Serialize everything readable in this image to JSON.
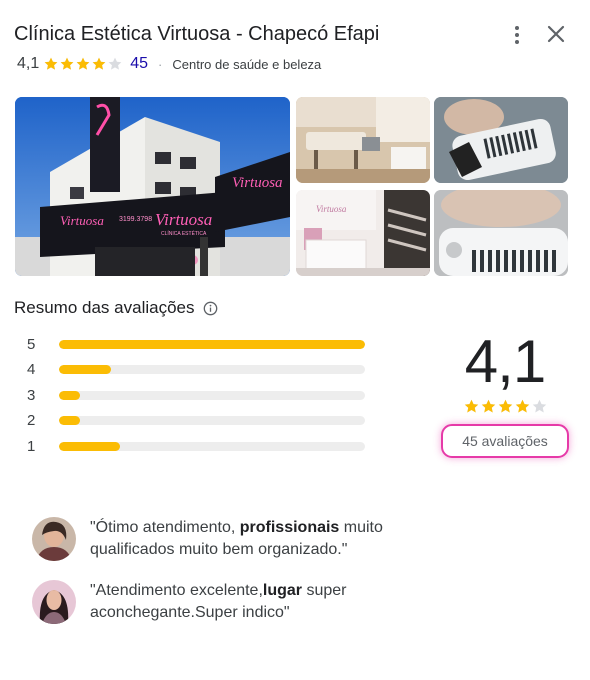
{
  "header": {
    "title": "Clínica Estética Virtuosa - Chapecó Efapi",
    "rating": "4,1",
    "review_count": "45",
    "separator": "·",
    "category": "Centro de saúde e beleza",
    "menu_icon": "more-vert-icon",
    "close_icon": "close-icon"
  },
  "photos": {
    "facade_sign": "Virtuosa",
    "facade_sub": "CLÍNICA ESTÉTICA",
    "facade_phone": "3199.3798",
    "reception_sign": "Virtuosa"
  },
  "summary": {
    "title": "Resumo das avaliações",
    "info_icon": "info-icon",
    "distribution": [
      {
        "label": "5",
        "fraction": 1.0
      },
      {
        "label": "4",
        "fraction": 0.17
      },
      {
        "label": "3",
        "fraction": 0.07
      },
      {
        "label": "2",
        "fraction": 0.07
      },
      {
        "label": "1",
        "fraction": 0.2
      }
    ],
    "average": "4,1",
    "stars_filled": 4.1,
    "reviews_link": "45 avaliações",
    "star_color": "#fbbc04",
    "highlight_color": "#e63aa8"
  },
  "reviews": [
    {
      "pre": "\"Ótimo atendimento, ",
      "bold": "profissionais",
      "post": " muito qualificados muito bem organizado.\""
    },
    {
      "pre": "\"Atendimento excelente,",
      "bold": "lugar",
      "post": " super aconchegante.Super indico\""
    }
  ]
}
